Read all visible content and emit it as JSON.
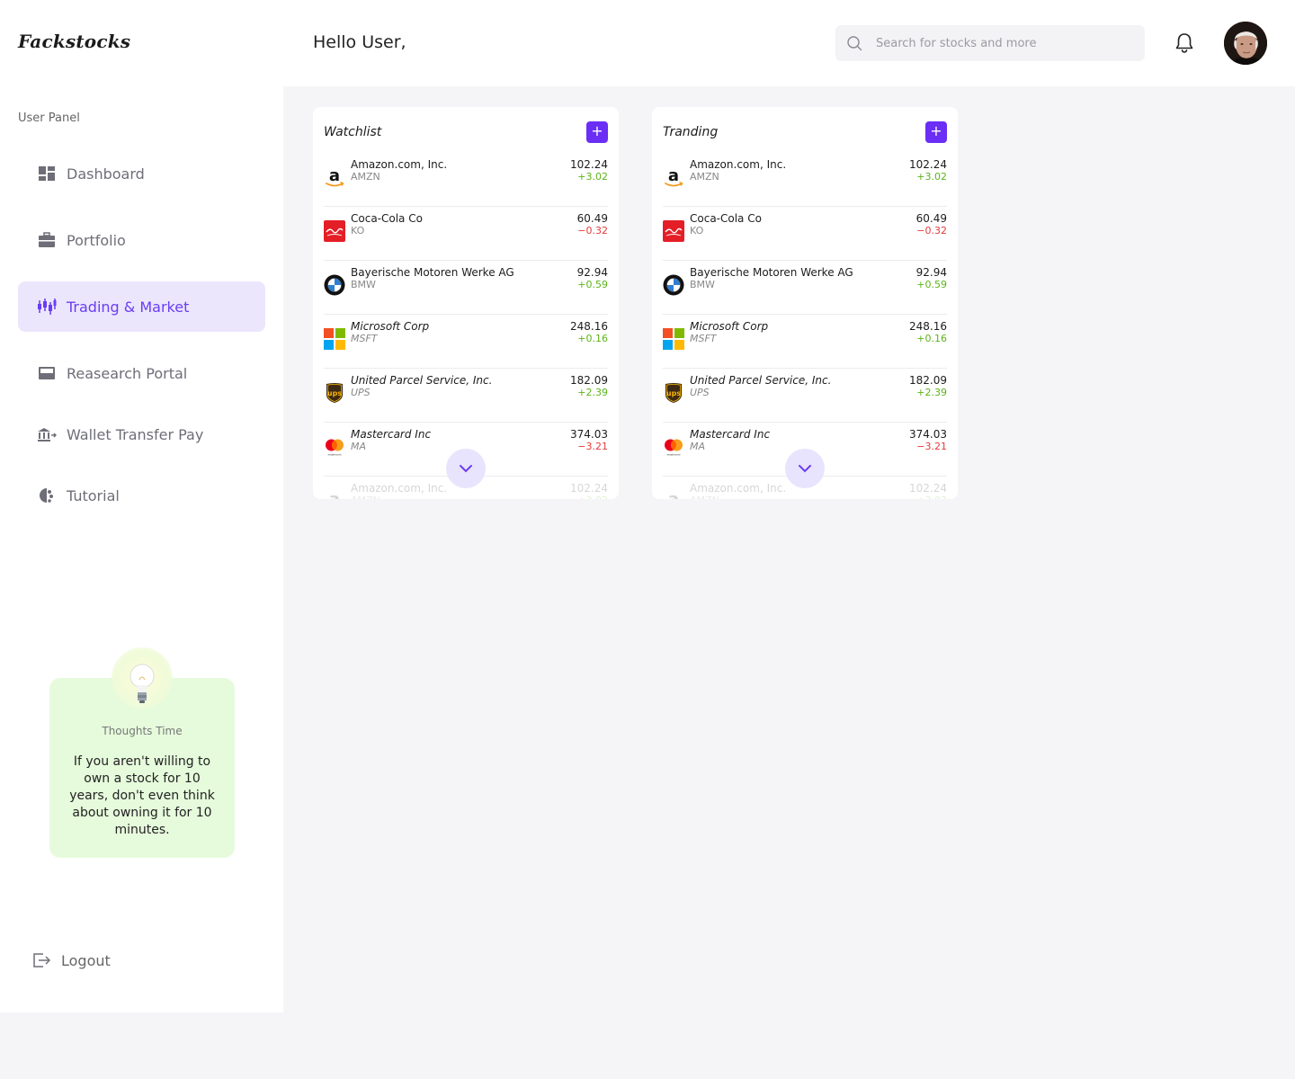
{
  "app": {
    "brand": "Fackstocks",
    "greeting": "Hello User,"
  },
  "search": {
    "placeholder": "Search for stocks and more",
    "value": ""
  },
  "sidebar": {
    "panel_label": "User Panel",
    "items": [
      {
        "label": "Dashboard",
        "icon": "dashboard-icon",
        "active": false
      },
      {
        "label": "Portfolio",
        "icon": "briefcase-icon",
        "active": false
      },
      {
        "label": "Trading & Market",
        "icon": "candlestick-icon",
        "active": true
      },
      {
        "label": "Reasearch Portal",
        "icon": "inbox-icon",
        "active": false
      },
      {
        "label": "Wallet Transfer Pay",
        "icon": "bank-transfer-icon",
        "active": false
      },
      {
        "label": "Tutorial",
        "icon": "tutorial-icon",
        "active": false
      }
    ],
    "thought": {
      "title": "Thoughts Time",
      "text": "If you aren't willing to own a stock for 10 years, don't even think about owning it for 10 minutes."
    },
    "logout_label": "Logout"
  },
  "colors": {
    "accent": "#6a2ef5",
    "active_bg": "#ece6fd",
    "positive": "#5db319",
    "negative": "#e53b3b",
    "thought_bg": "#e6fbdc"
  },
  "cards": [
    {
      "title": "Watchlist",
      "add_label": "+"
    },
    {
      "title": "Tranding",
      "add_label": "+"
    }
  ],
  "stocks": [
    {
      "name": "Amazon.com, Inc.",
      "ticker": "AMZN",
      "price": "102.24",
      "change": "+3.02",
      "direction": "up",
      "logo": "amazon-logo"
    },
    {
      "name": "Coca-Cola Co",
      "ticker": "KO",
      "price": "60.49",
      "change": "−0.32",
      "direction": "down",
      "logo": "coca-cola-logo"
    },
    {
      "name": "Bayerische Motoren Werke AG",
      "ticker": "BMW",
      "price": "92.94",
      "change": "+0.59",
      "direction": "up",
      "logo": "bmw-logo"
    },
    {
      "name": "Microsoft Corp",
      "ticker": "MSFT",
      "price": "248.16",
      "change": "+0.16",
      "direction": "up",
      "logo": "microsoft-logo"
    },
    {
      "name": "United Parcel Service, Inc.",
      "ticker": "UPS",
      "price": "182.09",
      "change": "+2.39",
      "direction": "up",
      "logo": "ups-logo"
    },
    {
      "name": "Mastercard Inc",
      "ticker": "MA",
      "price": "374.03",
      "change": "−3.21",
      "direction": "down",
      "logo": "mastercard-logo"
    },
    {
      "name": "Amazon.com, Inc.",
      "ticker": "AMZN",
      "price": "102.24",
      "change": "+3.02",
      "direction": "up",
      "logo": "amazon-logo"
    }
  ]
}
